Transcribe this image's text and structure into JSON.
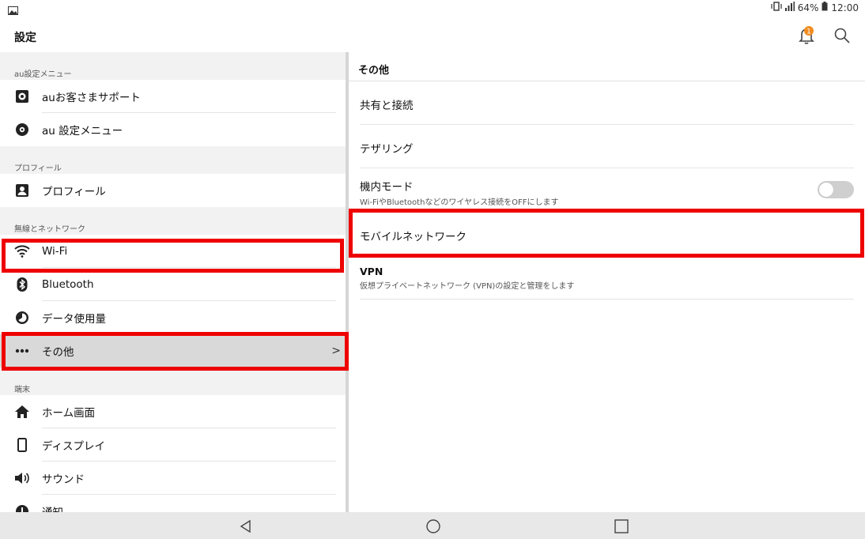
{
  "status_bar": {
    "battery": "64%",
    "time": "12:00"
  },
  "app_bar": {
    "title": "設定",
    "notification_badge": "1"
  },
  "left_menu": {
    "sections": [
      {
        "header": "au設定メニュー",
        "items": [
          {
            "label": "auお客さまサポート",
            "icon": "au-support-icon"
          },
          {
            "label": "au 設定メニュー",
            "icon": "au-settings-icon"
          }
        ]
      },
      {
        "header": "プロフィール",
        "items": [
          {
            "label": "プロフィール",
            "icon": "profile-icon"
          }
        ]
      },
      {
        "header": "無線とネットワーク",
        "items": [
          {
            "label": "Wi-Fi",
            "icon": "wifi-icon"
          },
          {
            "label": "Bluetooth",
            "icon": "bluetooth-icon"
          },
          {
            "label": "データ使用量",
            "icon": "data-usage-icon"
          },
          {
            "label": "その他",
            "icon": "more-icon",
            "selected": true
          }
        ]
      },
      {
        "header": "端末",
        "items": [
          {
            "label": "ホーム画面",
            "icon": "home-icon"
          },
          {
            "label": "ディスプレイ",
            "icon": "display-icon"
          },
          {
            "label": "サウンド",
            "icon": "sound-icon"
          },
          {
            "label": "通知",
            "icon": "notification-icon"
          }
        ]
      }
    ]
  },
  "right_panel": {
    "title": "その他",
    "items": [
      {
        "label": "共有と接続"
      },
      {
        "label": "テザリング"
      },
      {
        "label": "機内モード",
        "description": "Wi-FiやBluetoothなどのワイヤレス接続をOFFにします",
        "toggle": "off"
      },
      {
        "label": "モバイルネットワーク"
      },
      {
        "label": "VPN",
        "description": "仮想プライベートネットワーク (VPN)の設定と管理をします"
      }
    ]
  },
  "nav_bar": {
    "buttons": [
      "back-icon",
      "home-circle-icon",
      "recents-icon"
    ]
  },
  "colors": {
    "highlight": "#ee0000",
    "notification_badge": "#f28c1e",
    "selected_row": "#d9d9d9",
    "section_background": "#f2f2f2"
  }
}
